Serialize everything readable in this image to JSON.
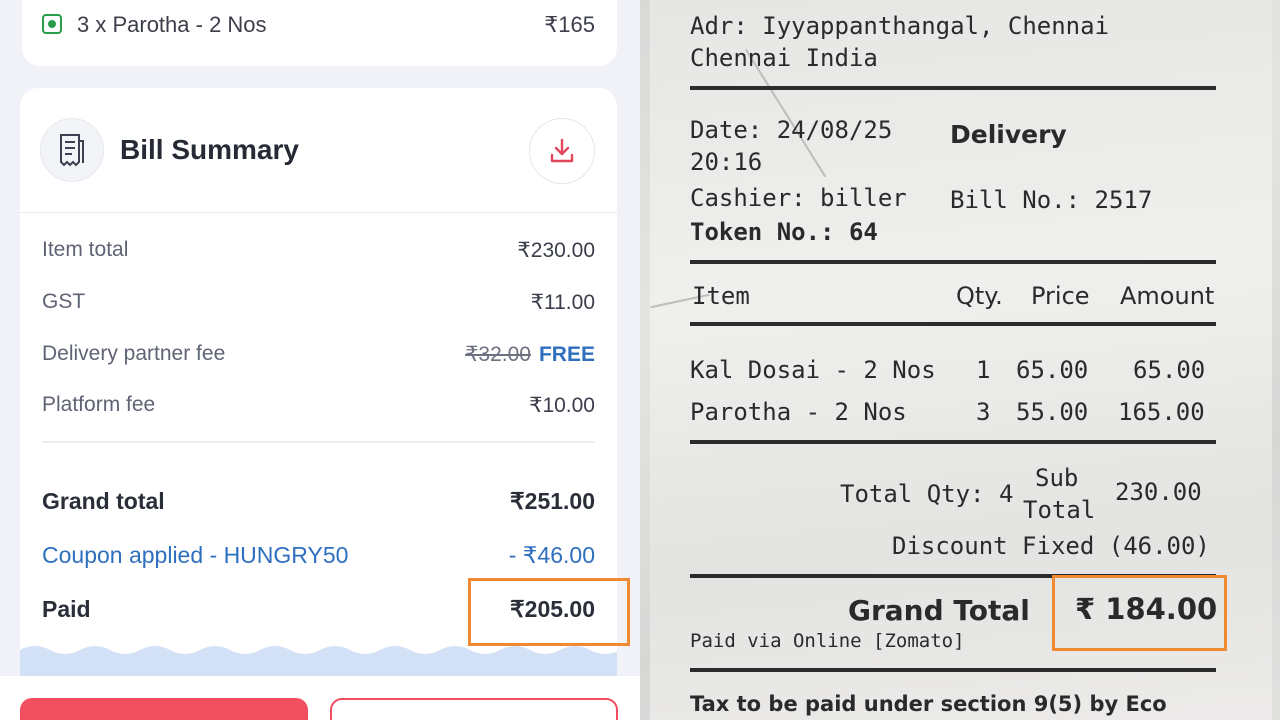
{
  "app": {
    "item_row": {
      "name": "3 x Parotha - 2 Nos",
      "price": "₹165",
      "veg_icon": "veg-indicator-icon"
    },
    "bill_summary": {
      "title": "Bill Summary",
      "icons": {
        "summary": "receipt-icon",
        "download": "download-icon"
      },
      "rows": [
        {
          "label": "Item total",
          "value": "₹230.00"
        },
        {
          "label": "GST",
          "value": "₹11.00"
        },
        {
          "label": "Delivery partner fee",
          "original": "₹32.00",
          "value": "FREE"
        },
        {
          "label": "Platform fee",
          "value": "₹10.00"
        }
      ],
      "grand_total": {
        "label": "Grand total",
        "value": "₹251.00"
      },
      "coupon": {
        "label": "Coupon applied - HUNGRY50",
        "value": "- ₹46.00"
      },
      "paid": {
        "label": "Paid",
        "value": "₹205.00"
      }
    },
    "colors": {
      "accent": "#ef4f5f",
      "link": "#2f6fbf",
      "highlight": "#ef8a33",
      "veg": "#2a9d4a"
    }
  },
  "receipt": {
    "address_line1": "Adr: Iyyappanthangal, Chennai",
    "address_line2": "Chennai India",
    "date": "Date: 24/08/25",
    "time": "20:16",
    "order_type": "Delivery",
    "cashier": "Cashier: biller",
    "bill_no": "Bill No.: 2517",
    "token": "Token No.: 64",
    "columns": {
      "item": "Item",
      "qty": "Qty.",
      "price": "Price",
      "amount": "Amount"
    },
    "items": [
      {
        "name": "Kal Dosai - 2 Nos",
        "qty": "1",
        "price": "65.00",
        "amount": "65.00"
      },
      {
        "name": "Parotha - 2 Nos",
        "qty": "3",
        "price": "55.00",
        "amount": "165.00"
      }
    ],
    "total_qty": "Total Qty: 4",
    "sub_total_label_1": "Sub",
    "sub_total_label_2": "Total",
    "sub_total_value": "230.00",
    "discount": "Discount Fixed (46.00)",
    "grand_total_label": "Grand Total",
    "grand_total_value": "₹ 184.00",
    "paid_via": "Paid via Online [Zomato]",
    "tax_note": "Tax to be paid under section 9(5) by Eco"
  }
}
